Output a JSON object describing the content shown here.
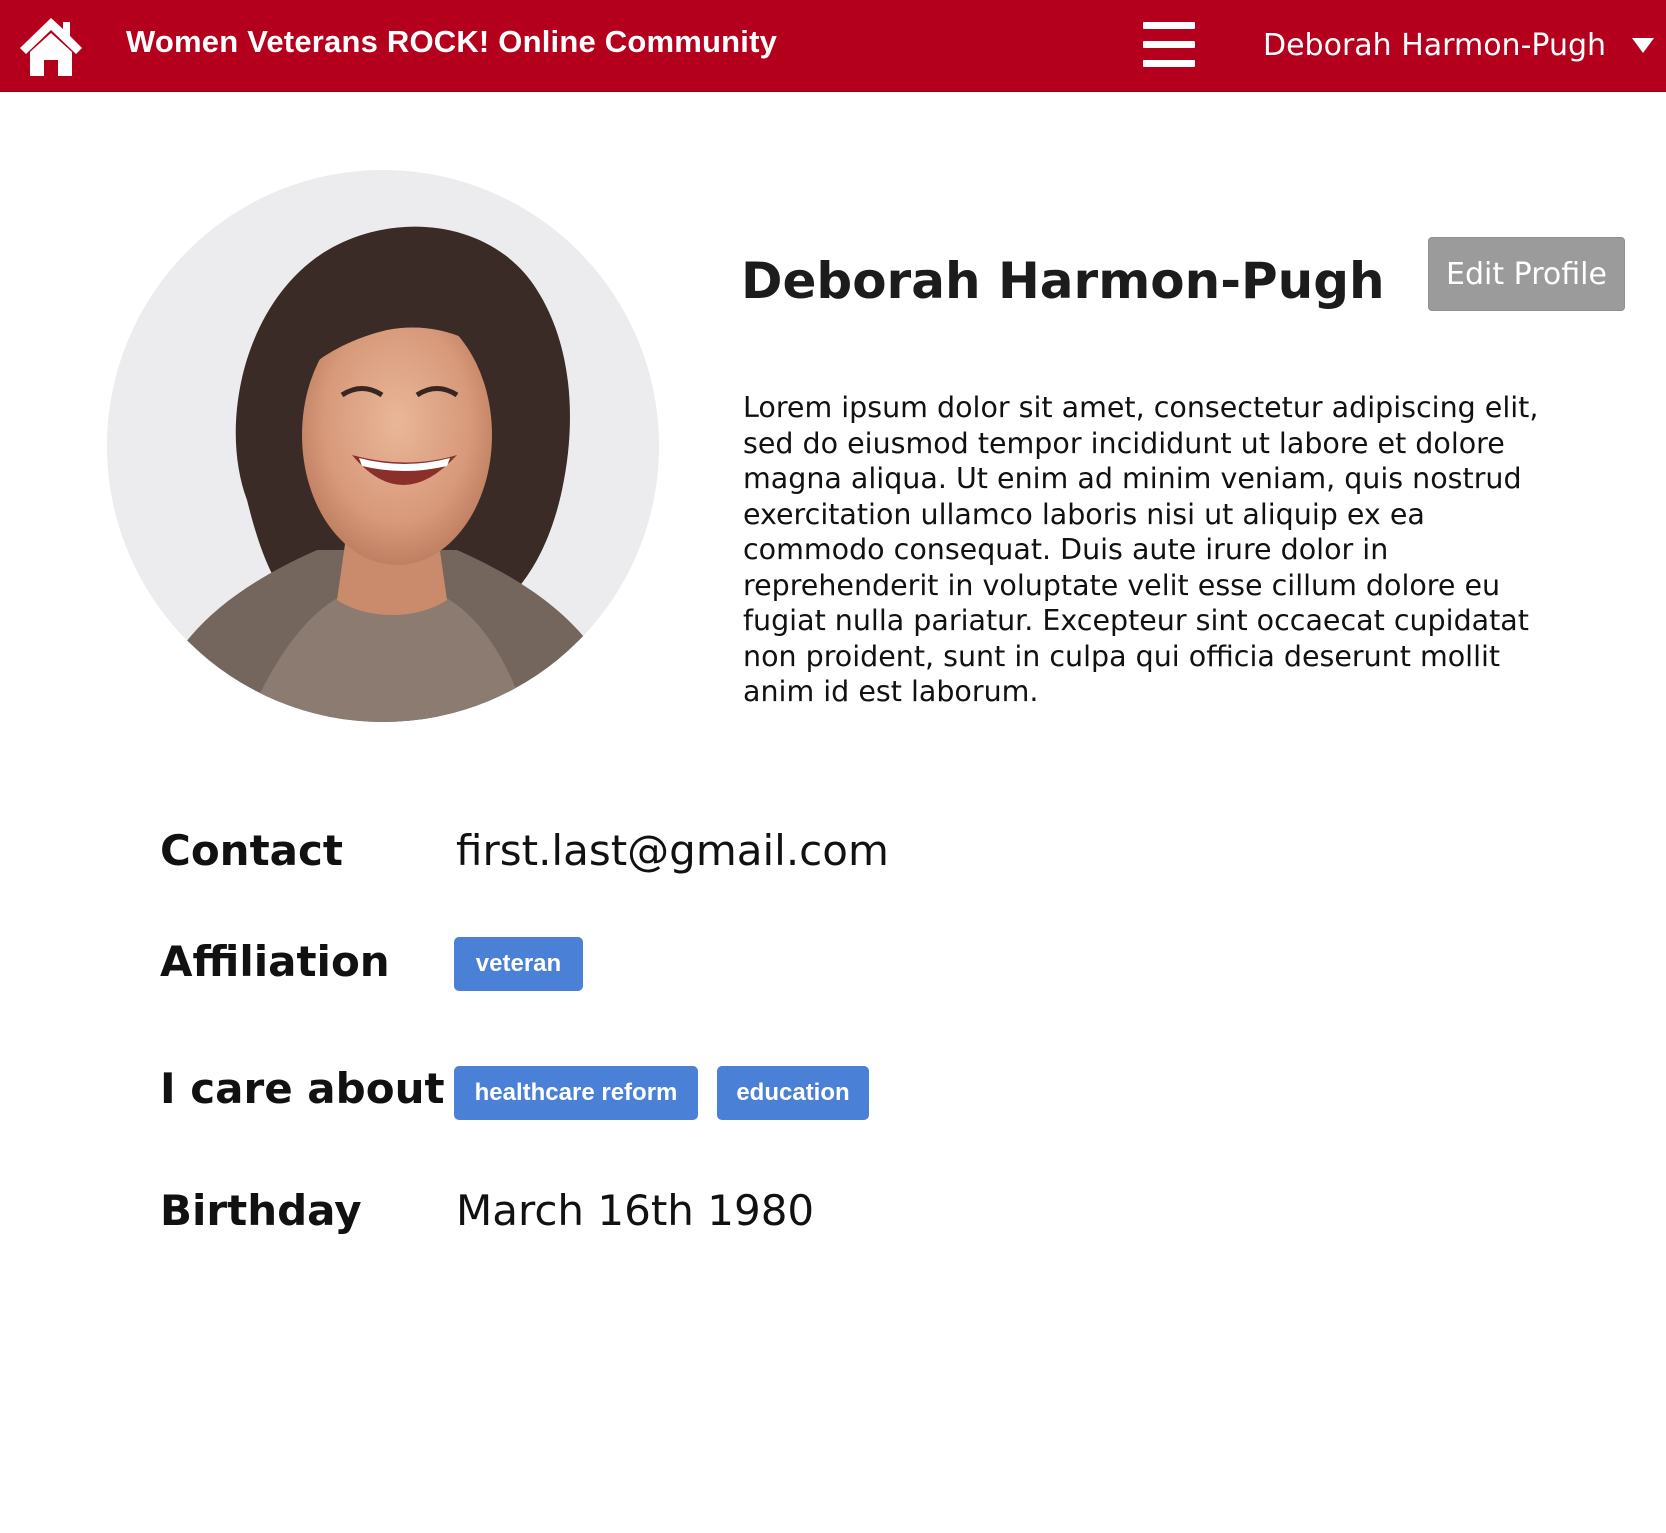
{
  "header": {
    "home_icon": "home-icon",
    "title": "Women Veterans ROCK! Online Community",
    "menu_icon": "hamburger-menu-icon",
    "user_name": "Deborah Harmon-Pugh",
    "user_caret_icon": "caret-down-icon",
    "colors": {
      "background": "#b5001d",
      "text": "#ffffff"
    }
  },
  "profile": {
    "name": "Deborah Harmon-Pugh",
    "edit_button_label": "Edit Profile",
    "bio": "Lorem ipsum dolor sit amet, consectetur adipiscing elit, sed do eiusmod tempor incididunt ut labore et dolore magna aliqua. Ut enim ad minim veniam, quis nostrud exercitation ullamco laboris nisi ut aliquip ex ea commodo consequat. Duis aute irure dolor in reprehenderit in voluptate velit esse cillum dolore eu fugiat nulla pariatur. Excepteur sint occaecat cupidatat non proident, sunt in culpa qui officia deserunt mollit anim id est laborum."
  },
  "details": {
    "contact": {
      "label": "Contact",
      "value": "first.last@gmail.com"
    },
    "affiliation": {
      "label": "Affiliation",
      "tags": [
        "veteran"
      ]
    },
    "interests": {
      "label": "I care about",
      "tags": [
        "healthcare reform",
        "education"
      ]
    },
    "birthday": {
      "label": "Birthday",
      "value": "March 16th 1980"
    }
  },
  "colors": {
    "tag": "#4a80d6",
    "edit_button": "#9b9b9b"
  }
}
